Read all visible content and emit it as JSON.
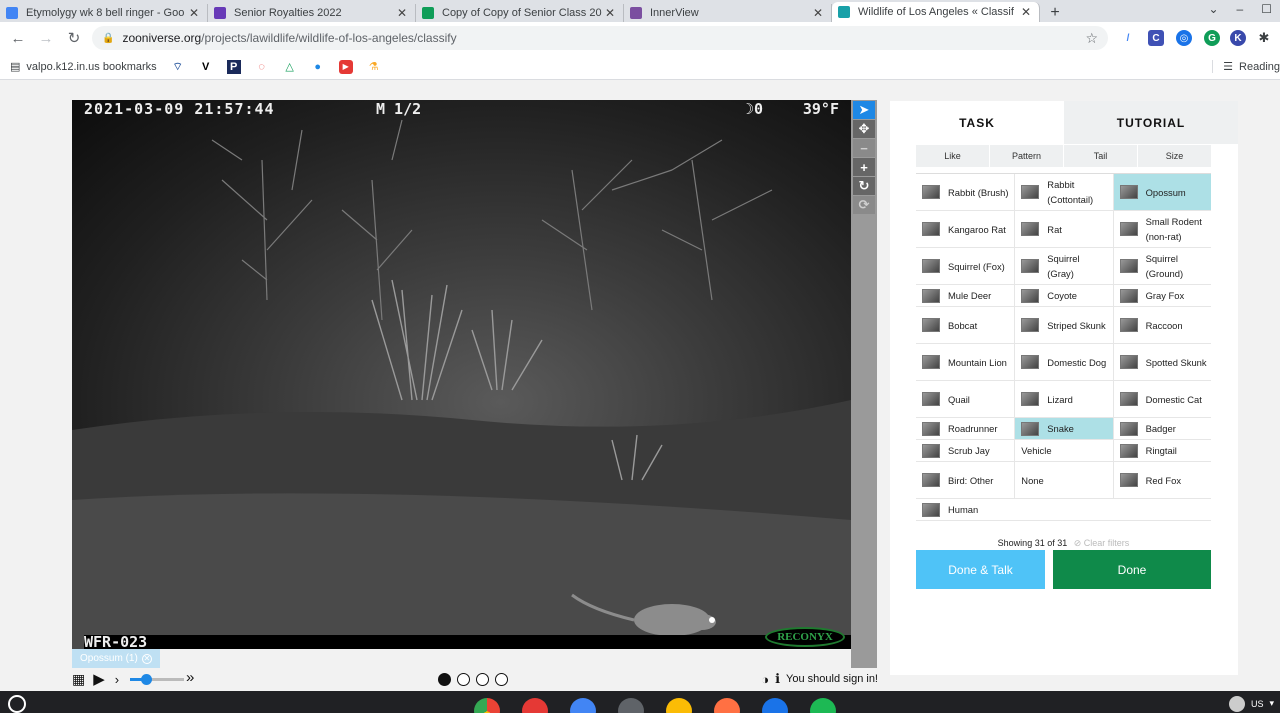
{
  "browser": {
    "tabs": [
      {
        "title": "Etymolygy wk 8 bell ringer - Goo",
        "icon_color": "#4285f4",
        "active": false
      },
      {
        "title": "Senior Royalties 2022",
        "icon_color": "#673ab7",
        "active": false
      },
      {
        "title": "Copy of Copy of Senior Class 20",
        "icon_color": "#0f9d58",
        "active": false
      },
      {
        "title": "InnerView",
        "icon_color": "#7b4fa0",
        "active": false
      },
      {
        "title": "Wildlife of Los Angeles « Classif",
        "icon_color": "#18a0a8",
        "active": true
      }
    ],
    "close_glyph": "✕",
    "new_tab_glyph": "+",
    "window_controls": [
      "⌄",
      "–",
      "☐"
    ],
    "url_host": "zooniverse.org",
    "url_path": "/projects/lawildlife/wildlife-of-los-angeles/classify",
    "bookmarks_folder": "valpo.k12.in.us bookmarks",
    "bookmark_icons": [
      "wifi-icon",
      "v-icon",
      "p-icon",
      "ring-icon",
      "drive-icon",
      "globe-icon",
      "youtube-icon",
      "flask-icon"
    ],
    "reading_list": "Reading"
  },
  "viewer": {
    "timestamp": "2021-03-09 21:57:44",
    "mode": "M 1/2",
    "moon": "☽0",
    "temperature": "39°F",
    "camera_id": "WFR-023",
    "brand": "RECONYX",
    "tools": [
      {
        "name": "pointer-tool",
        "glyph": "➤",
        "active": true,
        "dim": false
      },
      {
        "name": "pan-tool",
        "glyph": "✥",
        "active": false,
        "dim": false
      },
      {
        "name": "zoom-out-tool",
        "glyph": "−",
        "active": false,
        "dim": true
      },
      {
        "name": "zoom-in-tool",
        "glyph": "+",
        "active": false,
        "dim": false
      },
      {
        "name": "rotate-tool",
        "glyph": "↻",
        "active": false,
        "dim": false
      },
      {
        "name": "reset-tool",
        "glyph": "⟳",
        "active": false,
        "dim": true
      }
    ],
    "annotation_tag": "Opossum (1)",
    "annotation_close": "✕",
    "play_glyph": "▶",
    "grid_glyph": "▦",
    "speed_glyph": "›",
    "ffwd_glyph": "»",
    "playback_position": 0.3,
    "frames": 4,
    "current_frame": 1,
    "sign_in_message": "You should sign in!",
    "contrast_glyph": "◑",
    "info_glyph": "ℹ"
  },
  "panel": {
    "tabs": [
      "TASK",
      "TUTORIAL"
    ],
    "filters": [
      "Like",
      "Pattern",
      "Tail",
      "Size"
    ],
    "choices": [
      [
        {
          "label": "Rabbit (Brush)",
          "selected": false
        },
        {
          "label": "Rabbit (Cottontail)",
          "selected": false
        },
        {
          "label": "Opossum",
          "selected": true
        }
      ],
      [
        {
          "label": "Kangaroo Rat",
          "selected": false
        },
        {
          "label": "Rat",
          "selected": false
        },
        {
          "label": "Small Rodent (non-rat)",
          "selected": false
        }
      ],
      [
        {
          "label": "Squirrel (Fox)",
          "selected": false
        },
        {
          "label": "Squirrel (Gray)",
          "selected": false
        },
        {
          "label": "Squirrel (Ground)",
          "selected": false
        }
      ],
      [
        {
          "label": "Mule Deer",
          "selected": false
        },
        {
          "label": "Coyote",
          "selected": false
        },
        {
          "label": "Gray Fox",
          "selected": false
        }
      ],
      [
        {
          "label": "Bobcat",
          "selected": false
        },
        {
          "label": "Striped Skunk",
          "selected": false
        },
        {
          "label": "Raccoon",
          "selected": false
        }
      ],
      [
        {
          "label": "Mountain Lion",
          "selected": false
        },
        {
          "label": "Domestic Dog",
          "selected": false
        },
        {
          "label": "Spotted Skunk",
          "selected": false
        }
      ],
      [
        {
          "label": "Quail",
          "selected": false
        },
        {
          "label": "Lizard",
          "selected": false
        },
        {
          "label": "Domestic Cat",
          "selected": false
        }
      ],
      [
        {
          "label": "Roadrunner",
          "selected": false
        },
        {
          "label": "Snake",
          "selected": true
        },
        {
          "label": "Badger",
          "selected": false
        }
      ],
      [
        {
          "label": "Scrub Jay",
          "selected": false
        },
        {
          "label": "Vehicle",
          "selected": false,
          "no_thumb": true
        },
        {
          "label": "Ringtail",
          "selected": false
        }
      ],
      [
        {
          "label": "Bird: Other",
          "selected": false
        },
        {
          "label": "None",
          "selected": false,
          "no_thumb": true
        },
        {
          "label": "Red Fox",
          "selected": false
        }
      ],
      [
        {
          "label": "Human",
          "selected": false
        }
      ]
    ],
    "showing": "Showing 31 of 31",
    "clear_filters": "⊘ Clear filters",
    "done_talk": "Done & Talk",
    "done": "Done"
  },
  "shelf": {
    "tray": "US"
  }
}
